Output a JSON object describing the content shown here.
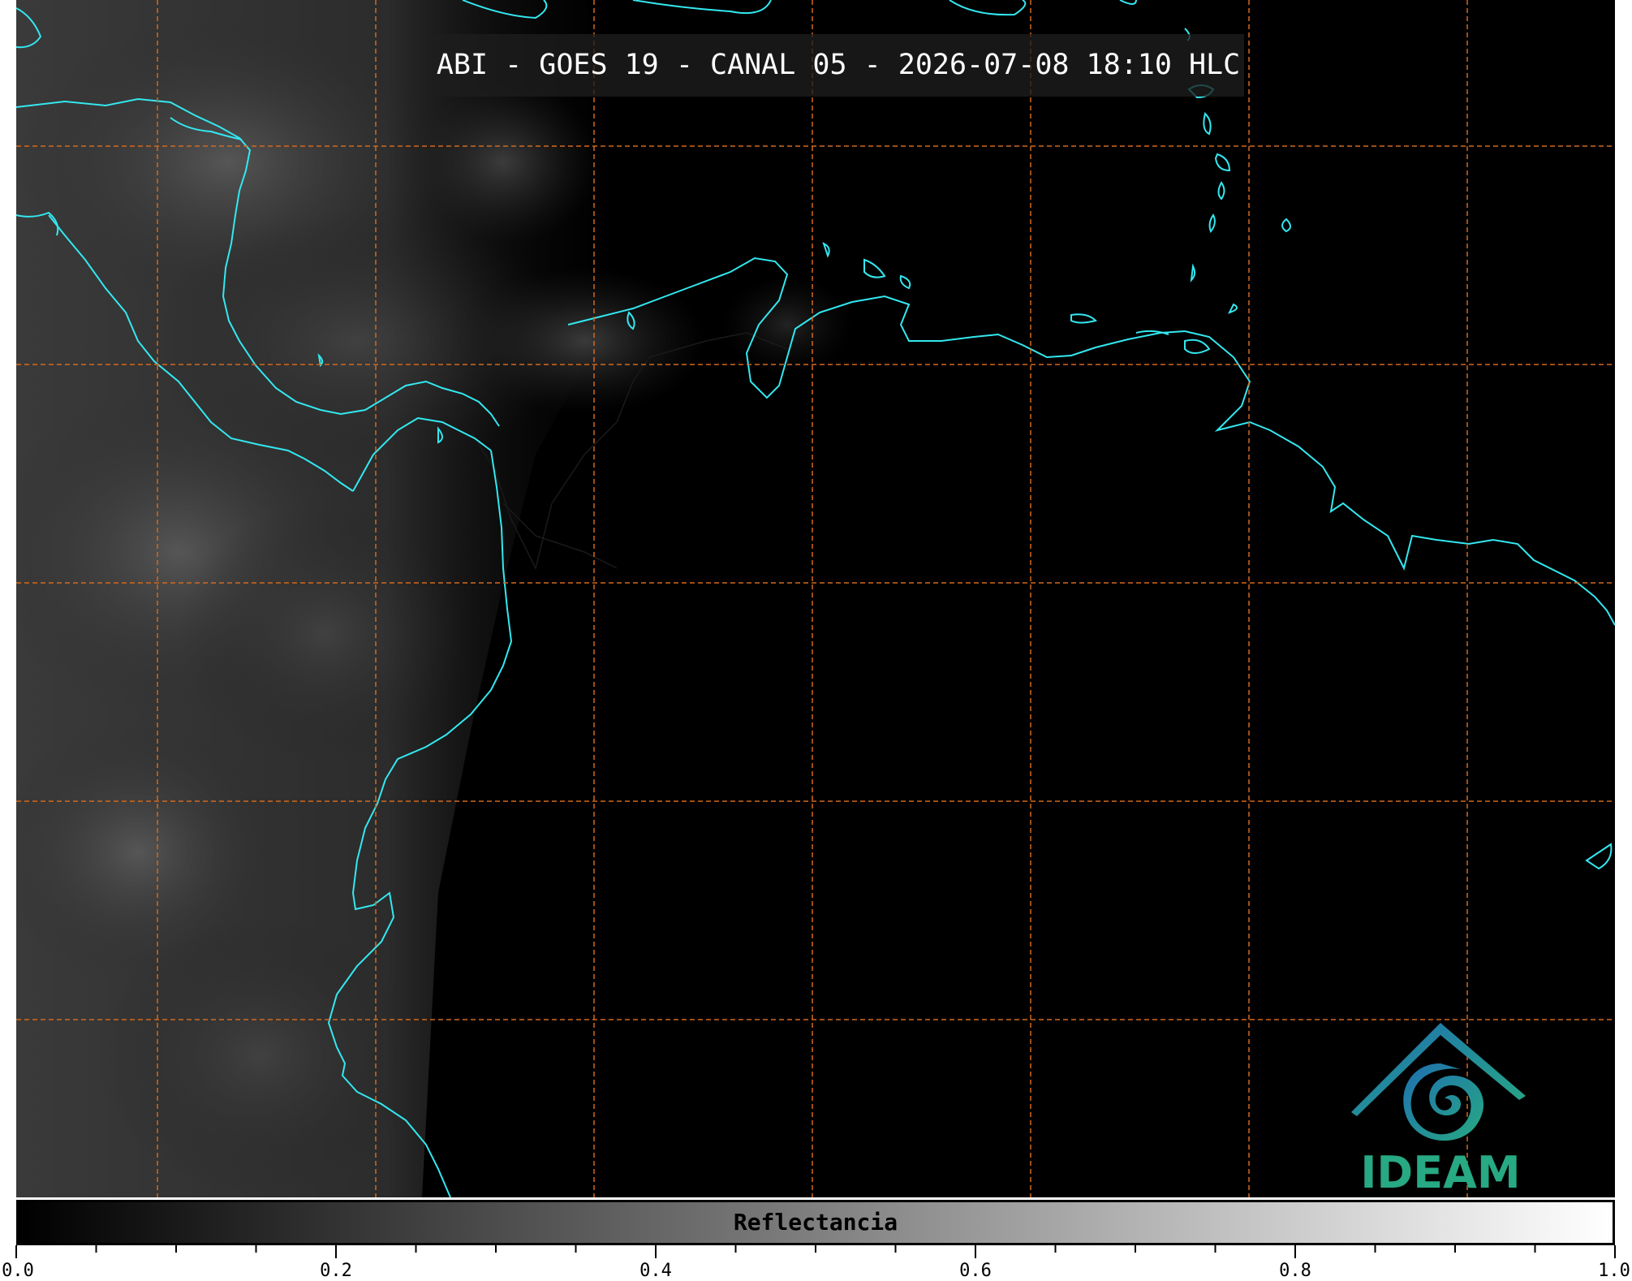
{
  "title": "ABI - GOES 19 - CANAL 05 - 2026-07-08 18:10 HLC",
  "colorbar": {
    "label": "Reflectancia",
    "min": 0.0,
    "max": 1.0,
    "major_ticks": [
      {
        "value": 0.0,
        "label": "0.0"
      },
      {
        "value": 0.2,
        "label": "0.2"
      },
      {
        "value": 0.4,
        "label": "0.4"
      },
      {
        "value": 0.6,
        "label": "0.6"
      },
      {
        "value": 0.8,
        "label": "0.8"
      },
      {
        "value": 1.0,
        "label": "1.0"
      }
    ],
    "minor_step": 0.05,
    "low_color": "#000000",
    "high_color": "#ffffff"
  },
  "logo": {
    "name": "ideam-logo",
    "text": "IDEAM",
    "primary_color": "#1f8fb0",
    "secondary_color": "#27a983"
  },
  "map": {
    "coastline_color": "#33e8f0",
    "border_color": "#222222",
    "grid_color": "#d2691e",
    "background_color": "#000000"
  }
}
